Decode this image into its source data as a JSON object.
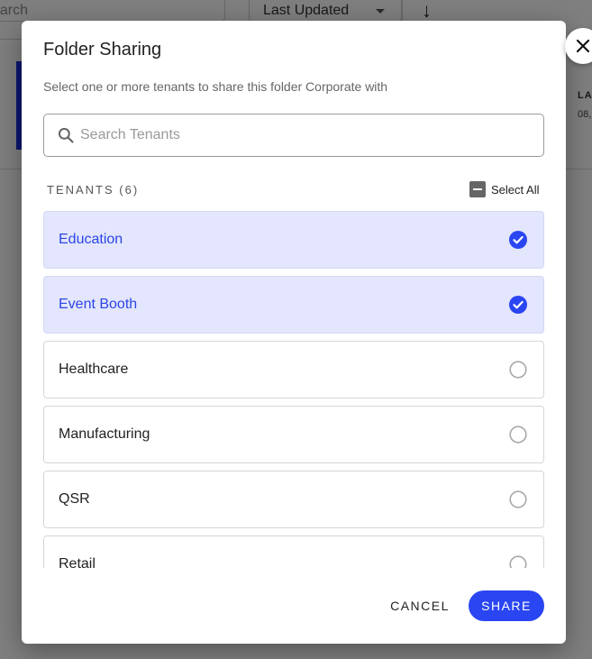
{
  "background": {
    "search_text": "earch",
    "sort_label": "Last Updated",
    "card_meta_label": "LA",
    "card_meta_value": "08,"
  },
  "dialog": {
    "title": "Folder Sharing",
    "subtitle": "Select one or more tenants to share this folder Corporate with",
    "close_icon": "close-icon",
    "search": {
      "placeholder": "Search Tenants",
      "value": ""
    },
    "tenants_heading": "TENANTS (6)",
    "select_all_label": "Select All",
    "tenants": [
      {
        "label": "Education",
        "selected": true
      },
      {
        "label": "Event Booth",
        "selected": true
      },
      {
        "label": "Healthcare",
        "selected": false
      },
      {
        "label": "Manufacturing",
        "selected": false
      },
      {
        "label": "QSR",
        "selected": false
      },
      {
        "label": "Retail",
        "selected": false
      }
    ],
    "cancel_label": "CANCEL",
    "share_label": "SHARE"
  },
  "colors": {
    "accent": "#2a46f2",
    "selected_bg": "#e3e6fc"
  }
}
